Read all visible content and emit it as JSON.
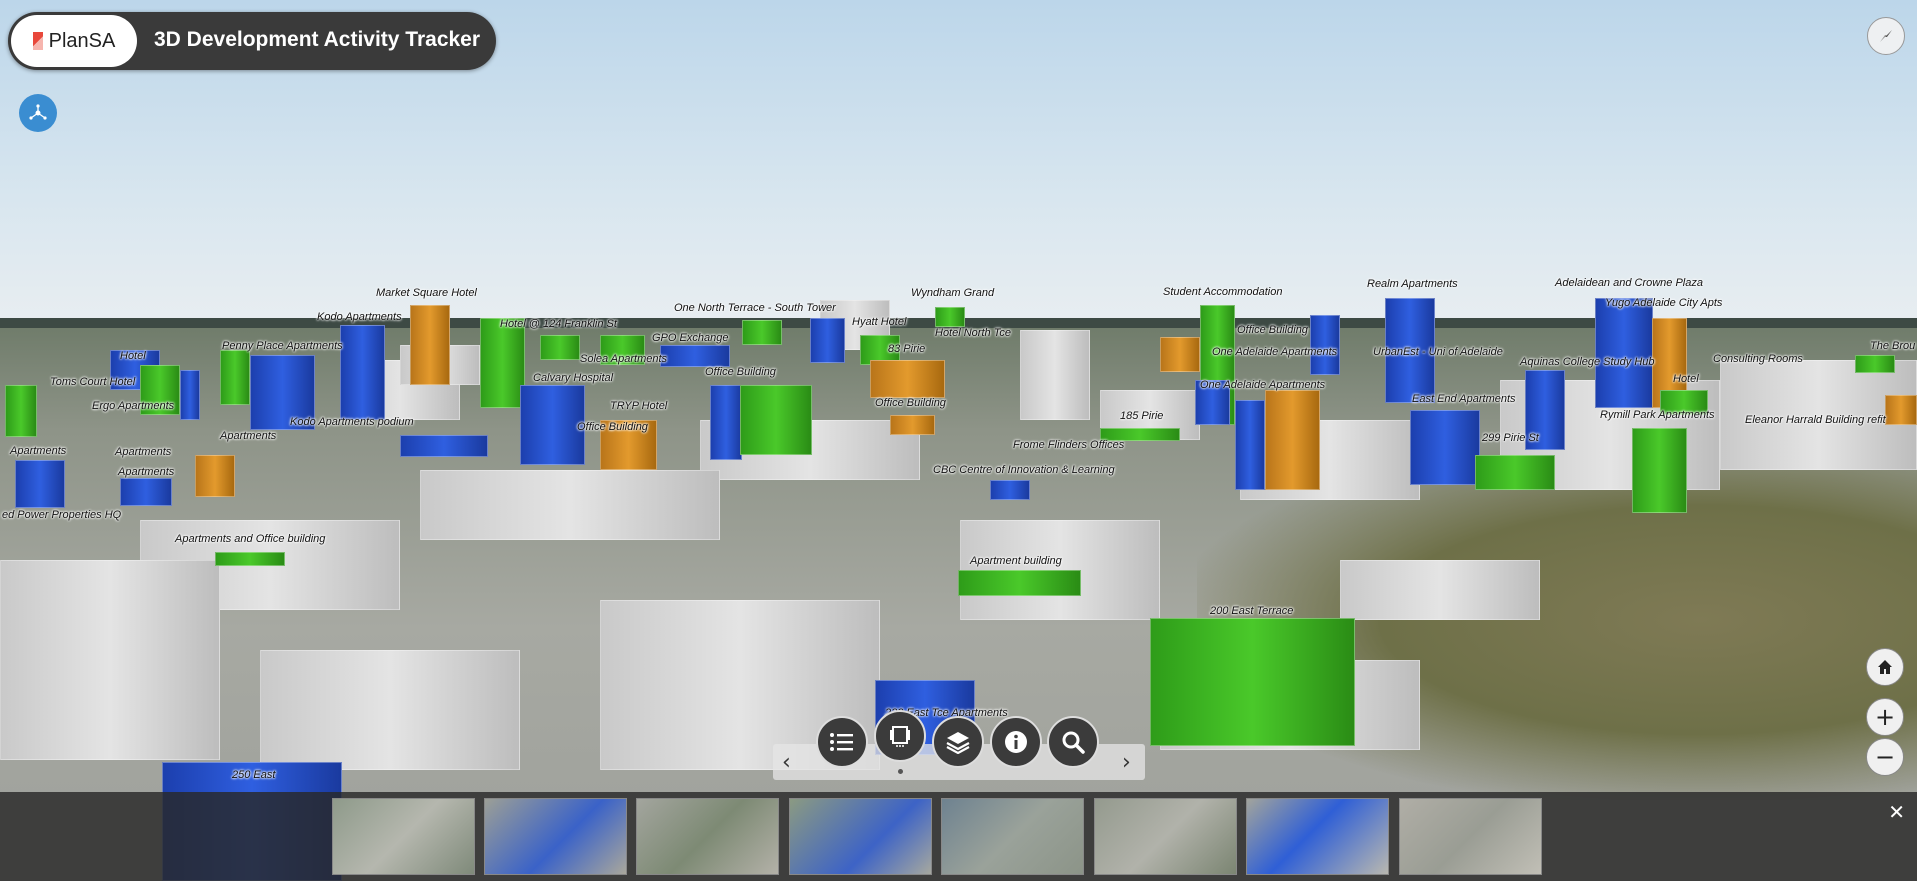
{
  "header": {
    "logo_text": "PlanSA",
    "title": "3D Development Activity Tracker"
  },
  "colors": {
    "proposed": "#2f5fe0",
    "approved": "#4ac92a",
    "under_construction": "#e39a2d",
    "existing": "#d9d9d9"
  },
  "map_labels": [
    "Market Square Hotel",
    "Kodo Apartments",
    "Hotel",
    "Penny Place Apartments",
    "Toms Court Hotel",
    "Ergo Apartments",
    "Kodo Apartments podium",
    "Apartments",
    "Apartments",
    "Apartments",
    "Apartments",
    "ed Power Properties HQ",
    "Apartments and Office building",
    "Hotel @ 124 Franklin St",
    "Solea Apartments",
    "GPO Exchange",
    "Calvary Hospital",
    "Office Building",
    "TRYP Hotel",
    "Office Building",
    "One North Terrace - South Tower",
    "Hyatt Hotel",
    "Wyndham Grand",
    "Hotel North Tce",
    "83 Pirie",
    "Office Building",
    "185 Pirie",
    "Frome Flinders Offices",
    "CBC Centre of Innovation & Learning",
    "Student Accommodation",
    "Office Building",
    "One Adelaide Apartments",
    "One Adelaide Apartments",
    "Realm Apartments",
    "UrbanEst - Uni of Adelaide",
    "East End Apartments",
    "299 Pirie St",
    "Adelaidean and Crowne Plaza",
    "Yugo Adelaide City Apts",
    "Aquinas College Study Hub",
    "Hotel",
    "Consulting Rooms",
    "Rymill Park Apartments",
    "Eleanor Harrald Building refit",
    "The Brou",
    "Apartment building",
    "200 East Terrace",
    "250 East",
    "233 East Tce Apartments"
  ],
  "toolbar": {
    "legend_icon": "list-icon",
    "slides_icon": "slides-icon",
    "layers_icon": "layers-icon",
    "info_icon": "info-icon",
    "search_icon": "search-icon",
    "prev": "‹",
    "next": "›"
  },
  "filmstrip": {
    "close_label": "✕",
    "slide_count": 8
  },
  "controls": {
    "home_icon": "home-icon",
    "zoom_in": "+",
    "zoom_out": "−"
  }
}
